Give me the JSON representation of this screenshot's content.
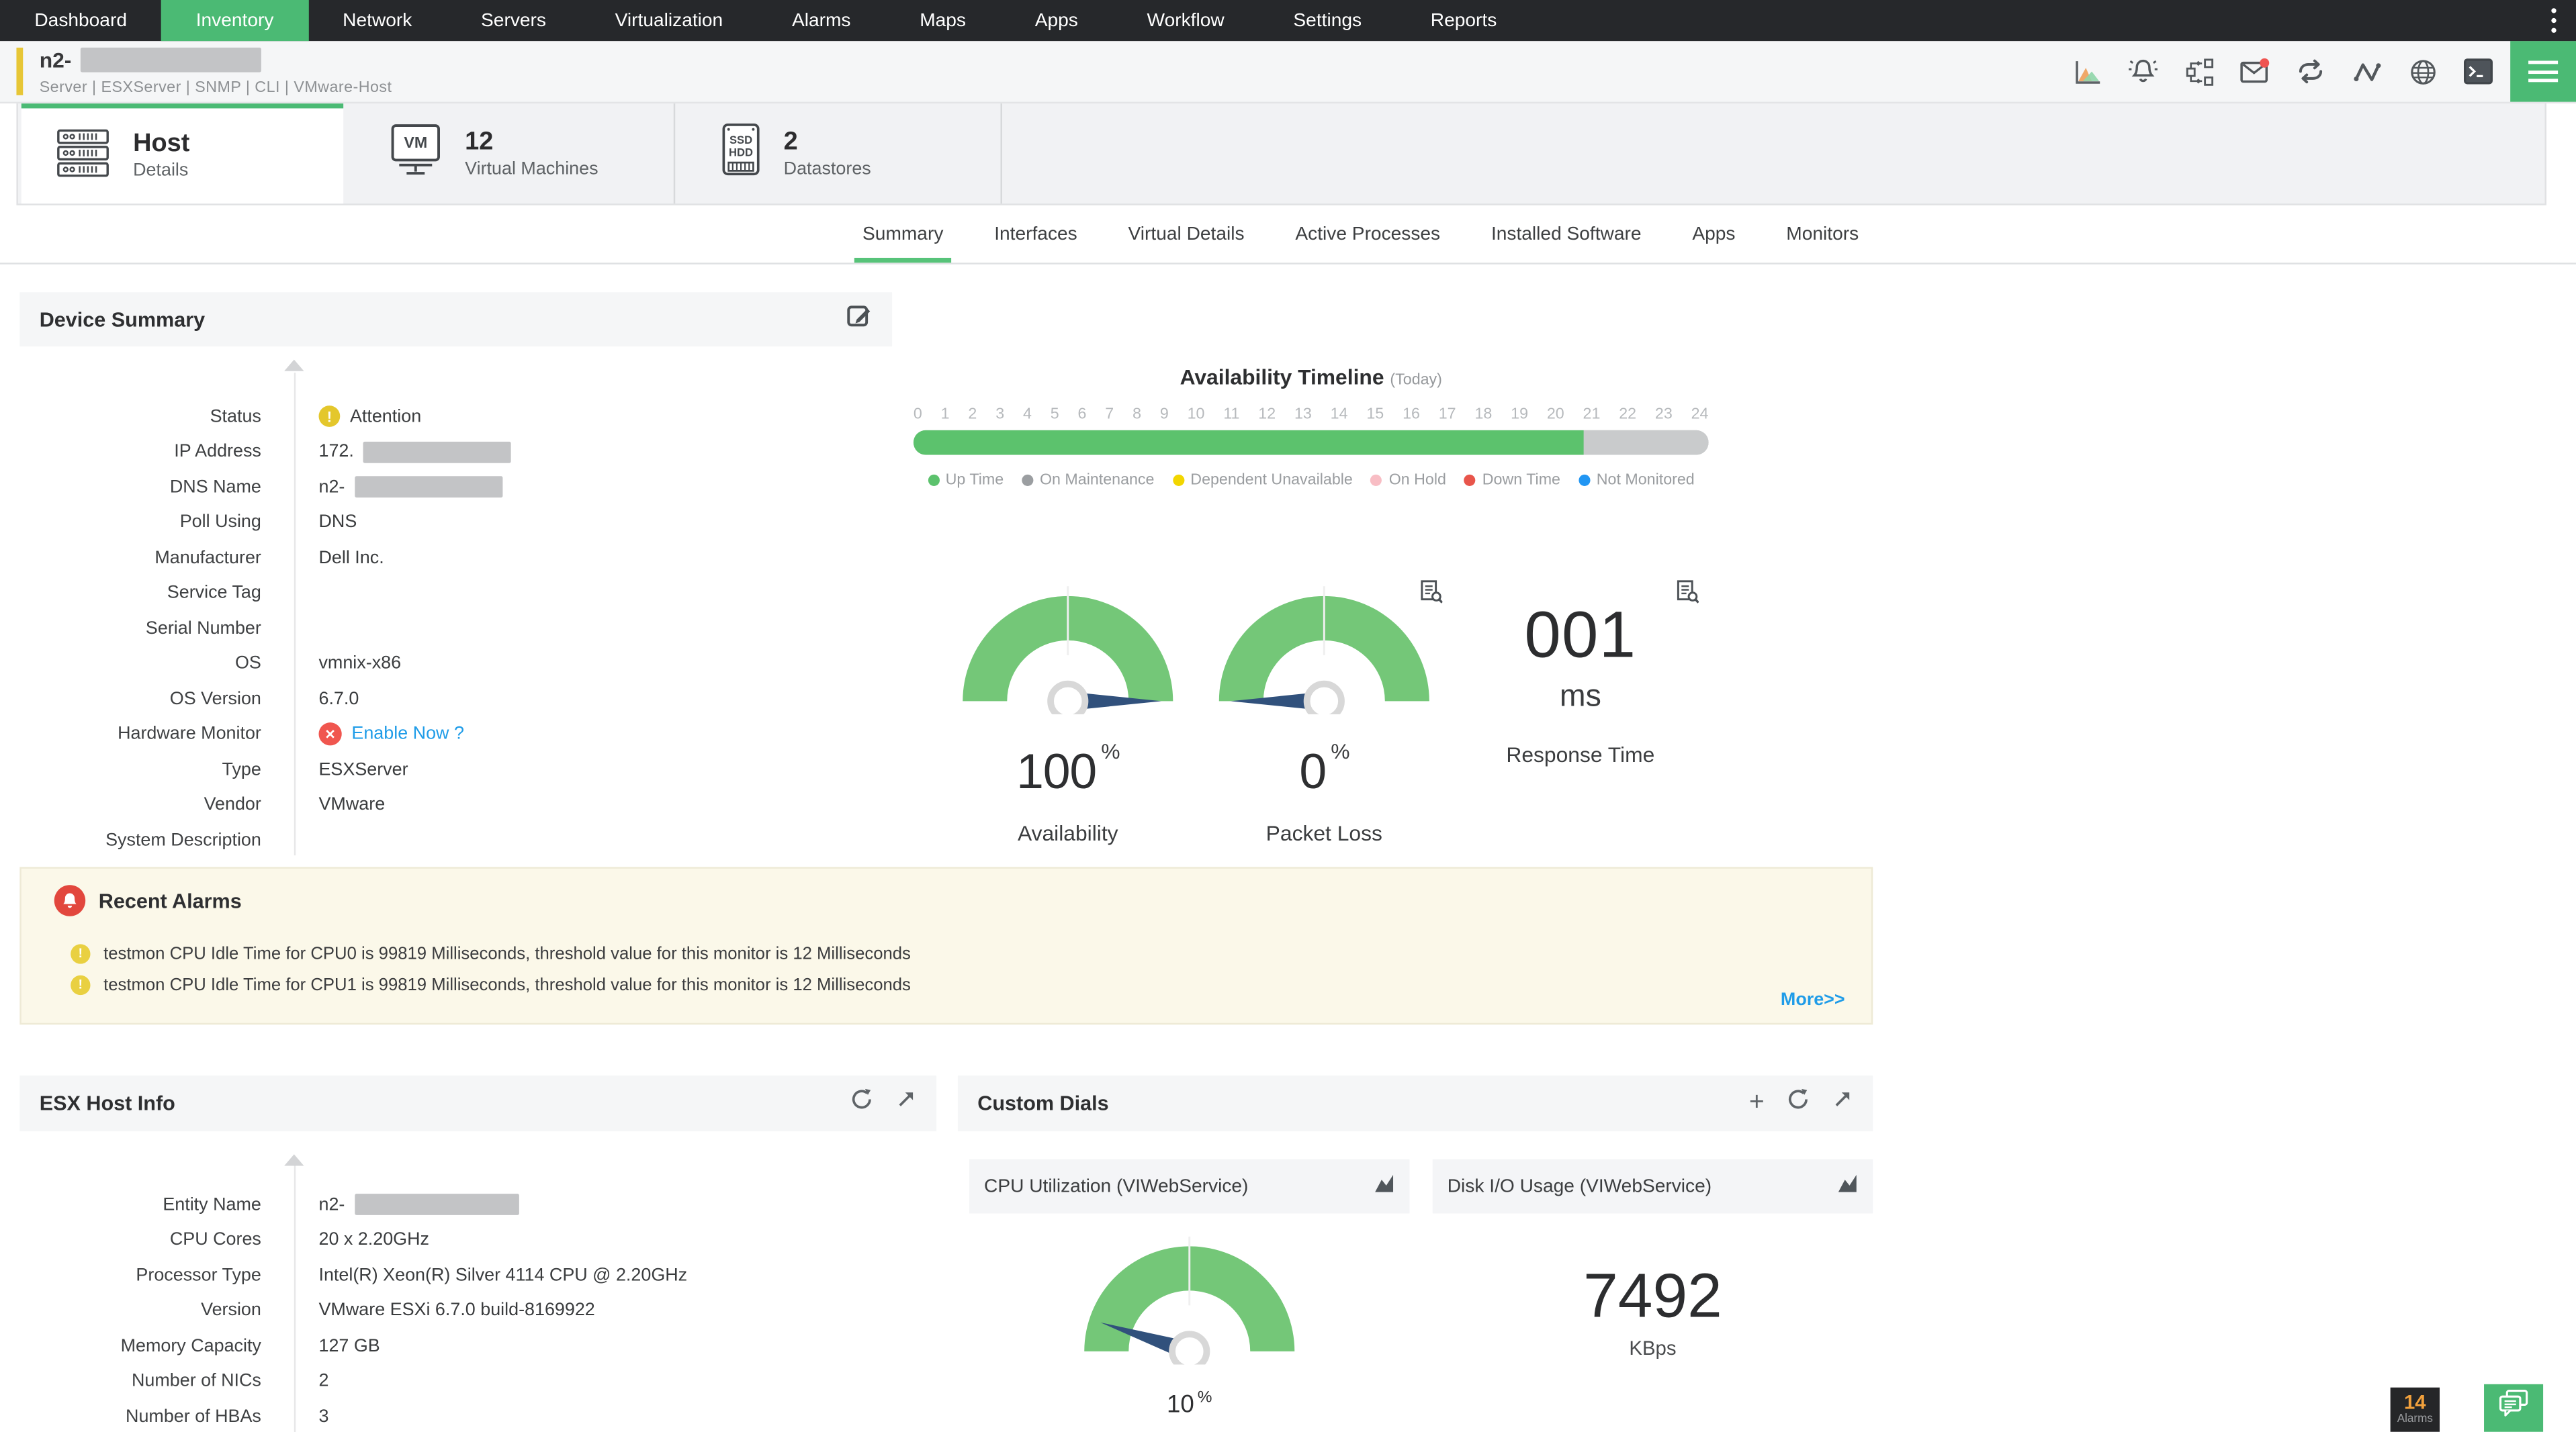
{
  "nav": {
    "items": [
      "Dashboard",
      "Inventory",
      "Network",
      "Servers",
      "Virtualization",
      "Alarms",
      "Maps",
      "Apps",
      "Workflow",
      "Settings",
      "Reports"
    ],
    "active": "Inventory"
  },
  "device_header": {
    "name_prefix": "n2-",
    "name_redacted": true,
    "meta": "Server | ESXServer | SNMP | CLI | VMware-Host",
    "toolbar_icons": [
      "performance-chart",
      "alarm-bell",
      "workflow",
      "email-notification",
      "sync-loop",
      "activity",
      "globe",
      "terminal",
      "menu"
    ]
  },
  "tabs": {
    "host": {
      "title": "Host",
      "subtitle": "Details"
    },
    "vms": {
      "count": "12",
      "label": "Virtual Machines"
    },
    "datastores": {
      "count": "2",
      "label": "Datastores"
    }
  },
  "subtabs": {
    "items": [
      "Summary",
      "Interfaces",
      "Virtual Details",
      "Active Processes",
      "Installed Software",
      "Apps",
      "Monitors"
    ],
    "active": "Summary"
  },
  "device_summary": {
    "title": "Device Summary",
    "fields": [
      {
        "label": "Status",
        "value": "Attention",
        "icon": "warning"
      },
      {
        "label": "IP Address",
        "value": "172.",
        "redacted": true
      },
      {
        "label": "DNS Name",
        "value": "n2-",
        "redacted": true
      },
      {
        "label": "Poll Using",
        "value": "DNS"
      },
      {
        "label": "Manufacturer",
        "value": "Dell Inc."
      },
      {
        "label": "Service Tag",
        "value": ""
      },
      {
        "label": "Serial Number",
        "value": ""
      },
      {
        "label": "OS",
        "value": "vmnix-x86"
      },
      {
        "label": "OS Version",
        "value": "6.7.0"
      },
      {
        "label": "Hardware Monitor",
        "value": "Enable Now ?",
        "icon": "disabled",
        "link": true
      },
      {
        "label": "Type",
        "value": "ESXServer"
      },
      {
        "label": "Vendor",
        "value": "VMware"
      },
      {
        "label": "System Description",
        "value": ""
      }
    ]
  },
  "availability_timeline": {
    "title": "Availability Timeline",
    "subtitle": "(Today)",
    "hours": [
      "0",
      "1",
      "2",
      "3",
      "4",
      "5",
      "6",
      "7",
      "8",
      "9",
      "10",
      "11",
      "12",
      "13",
      "14",
      "15",
      "16",
      "17",
      "18",
      "19",
      "20",
      "21",
      "22",
      "23",
      "24"
    ],
    "chart_data": {
      "type": "timeline-bar",
      "x_range": [
        0,
        24
      ],
      "segments": [
        {
          "label": "Up Time",
          "percent": 84.4,
          "color": "#5cc26d"
        },
        {
          "label": "Remaining (not monitored yet)",
          "percent": 15.6,
          "color": "#c9cbcc"
        }
      ]
    },
    "legend": [
      {
        "label": "Up Time",
        "color": "#5cc26d"
      },
      {
        "label": "On Maintenance",
        "color": "#9b9ea1"
      },
      {
        "label": "Dependent Unavailable",
        "color": "#f2d600"
      },
      {
        "label": "On Hold",
        "color": "#f8bdc4"
      },
      {
        "label": "Down Time",
        "color": "#e8554b"
      },
      {
        "label": "Not Monitored",
        "color": "#2196f3"
      }
    ]
  },
  "gauges": [
    {
      "name": "Availability",
      "display": "100",
      "unit": "%",
      "value": 100,
      "max": 100,
      "type": "gauge"
    },
    {
      "name": "Packet Loss",
      "display": "0",
      "unit": "%",
      "value": 0,
      "max": 100,
      "type": "gauge"
    },
    {
      "name": "Response Time",
      "display": "001",
      "unit": "ms",
      "type": "number"
    }
  ],
  "recent_alarms": {
    "title": "Recent Alarms",
    "items": [
      "testmon CPU Idle Time for CPU0 is 99819 Milliseconds, threshold value for this monitor is 12 Milliseconds",
      "testmon CPU Idle Time for CPU1 is 99819 Milliseconds, threshold value for this monitor is 12 Milliseconds"
    ],
    "more_label": "More>>"
  },
  "esx_host_info": {
    "title": "ESX Host Info",
    "fields": [
      {
        "label": "Entity Name",
        "value": "n2-",
        "redacted": true
      },
      {
        "label": "CPU Cores",
        "value": "20 x 2.20GHz"
      },
      {
        "label": "Processor Type",
        "value": "Intel(R) Xeon(R) Silver 4114 CPU @ 2.20GHz"
      },
      {
        "label": "Version",
        "value": "VMware ESXi 6.7.0 build-8169922"
      },
      {
        "label": "Memory Capacity",
        "value": "127 GB"
      },
      {
        "label": "Number of NICs",
        "value": "2"
      },
      {
        "label": "Number of HBAs",
        "value": "3"
      }
    ]
  },
  "custom_dials": {
    "title": "Custom Dials",
    "dials": [
      {
        "title": "CPU Utilization (VIWebService)",
        "type": "gauge",
        "display": "10",
        "unit": "%",
        "value": 10,
        "max": 100
      },
      {
        "title": "Disk I/O Usage (VIWebService)",
        "type": "number",
        "display": "7492",
        "unit": "KBps"
      }
    ]
  },
  "footer": {
    "alarm_count": "14",
    "alarm_label": "Alarms"
  },
  "colors": {
    "accent_green": "#4bba74",
    "underline_green": "#57c379",
    "gauge_green": "#74c778",
    "needle_navy": "#31517c",
    "nav_bg": "#26282b",
    "warning_yellow": "#e4c72c",
    "danger_red": "#f0564f",
    "link_blue": "#1f9ce8",
    "alarm_panel_bg": "#fbf8e9",
    "badge_orange": "#f2a13c",
    "accent_bar_yellow": "#e7c636"
  }
}
